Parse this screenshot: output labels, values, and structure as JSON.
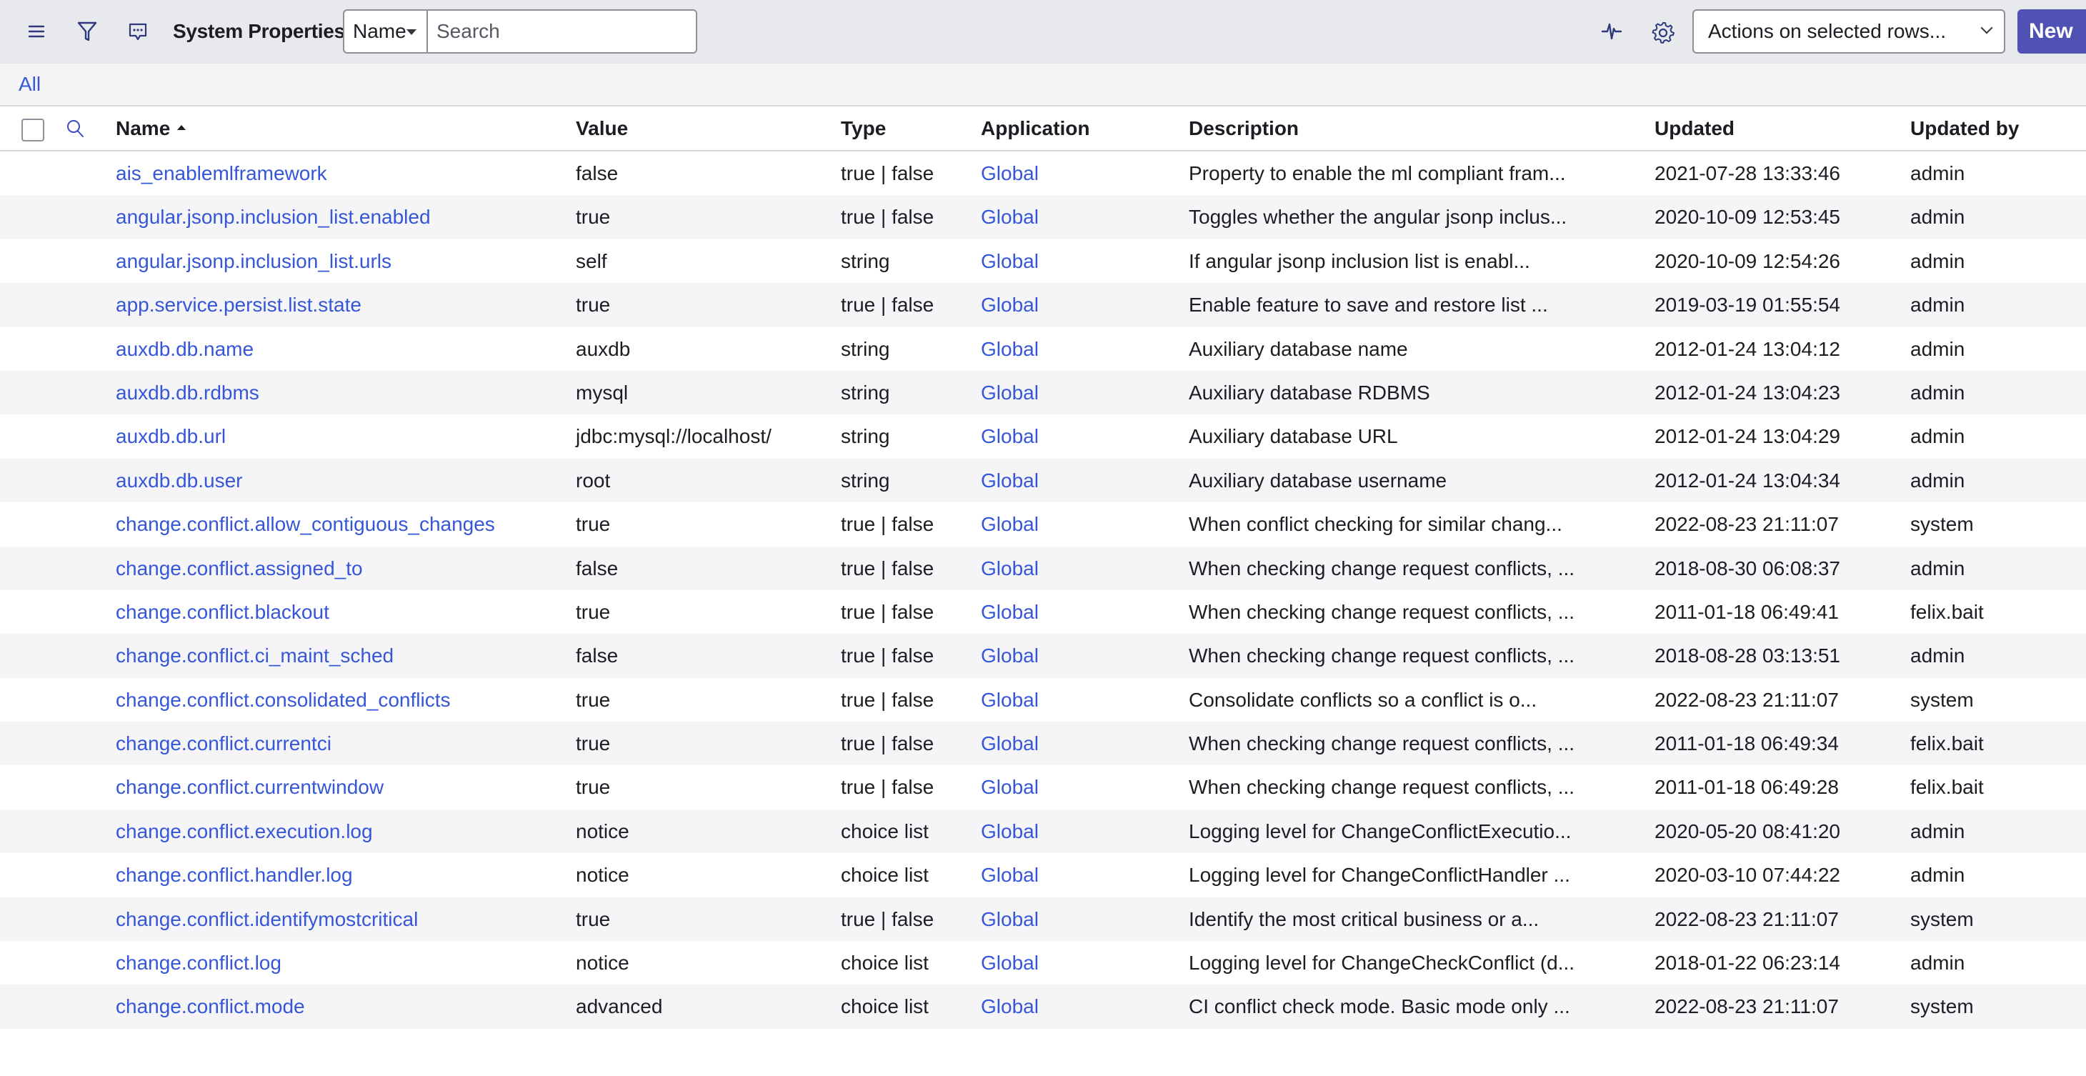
{
  "header": {
    "title": "System Properties",
    "search_field": "Name",
    "search_placeholder": "Search",
    "actions_select": "Actions on selected rows...",
    "new_button": "New",
    "icons": {
      "menu": "hamburger-menu-icon",
      "filter": "funnel-filter-icon",
      "chat": "chat-bubble-icon",
      "activity": "pulse-activity-icon",
      "settings": "gear-icon"
    }
  },
  "filter": {
    "breadcrumb": "All"
  },
  "colors": {
    "accent": "#4f52b2",
    "link": "#3656d8",
    "icon": "#2e3a7c"
  },
  "table": {
    "columns": [
      "Name",
      "Value",
      "Type",
      "Application",
      "Description",
      "Updated",
      "Updated by"
    ],
    "sort": {
      "column": "Name",
      "direction": "ascending"
    },
    "rows": [
      {
        "name": "ais_enablemlframework",
        "value": "false",
        "type": "true | false",
        "application": "Global",
        "description": "Property to enable the ml compliant fram...",
        "updated": "2021-07-28 13:33:46",
        "updated_by": "admin"
      },
      {
        "name": "angular.jsonp.inclusion_list.enabled",
        "value": "true",
        "type": "true | false",
        "application": "Global",
        "description": "Toggles whether the angular jsonp inclus...",
        "updated": "2020-10-09 12:53:45",
        "updated_by": "admin"
      },
      {
        "name": "angular.jsonp.inclusion_list.urls",
        "value": "self",
        "type": "string",
        "application": "Global",
        "description": "If angular jsonp inclusion list is enabl...",
        "updated": "2020-10-09 12:54:26",
        "updated_by": "admin"
      },
      {
        "name": "app.service.persist.list.state",
        "value": "true",
        "type": "true | false",
        "application": "Global",
        "description": "Enable feature to save and restore list ...",
        "updated": "2019-03-19 01:55:54",
        "updated_by": "admin"
      },
      {
        "name": "auxdb.db.name",
        "value": "auxdb",
        "type": "string",
        "application": "Global",
        "description": "Auxiliary database name",
        "updated": "2012-01-24 13:04:12",
        "updated_by": "admin"
      },
      {
        "name": "auxdb.db.rdbms",
        "value": "mysql",
        "type": "string",
        "application": "Global",
        "description": "Auxiliary database RDBMS",
        "updated": "2012-01-24 13:04:23",
        "updated_by": "admin"
      },
      {
        "name": "auxdb.db.url",
        "value": "jdbc:mysql://localhost/",
        "type": "string",
        "application": "Global",
        "description": "Auxiliary database URL",
        "updated": "2012-01-24 13:04:29",
        "updated_by": "admin"
      },
      {
        "name": "auxdb.db.user",
        "value": "root",
        "type": "string",
        "application": "Global",
        "description": "Auxiliary database username",
        "updated": "2012-01-24 13:04:34",
        "updated_by": "admin"
      },
      {
        "name": "change.conflict.allow_contiguous_changes",
        "value": "true",
        "type": "true | false",
        "application": "Global",
        "description": "When conflict checking for similar chang...",
        "updated": "2022-08-23 21:11:07",
        "updated_by": "system"
      },
      {
        "name": "change.conflict.assigned_to",
        "value": "false",
        "type": "true | false",
        "application": "Global",
        "description": "When checking change request conflicts, ...",
        "updated": "2018-08-30 06:08:37",
        "updated_by": "admin"
      },
      {
        "name": "change.conflict.blackout",
        "value": "true",
        "type": "true | false",
        "application": "Global",
        "description": "When checking change request conflicts, ...",
        "updated": "2011-01-18 06:49:41",
        "updated_by": "felix.bait"
      },
      {
        "name": "change.conflict.ci_maint_sched",
        "value": "false",
        "type": "true | false",
        "application": "Global",
        "description": "When checking change request conflicts, ...",
        "updated": "2018-08-28 03:13:51",
        "updated_by": "admin"
      },
      {
        "name": "change.conflict.consolidated_conflicts",
        "value": "true",
        "type": "true | false",
        "application": "Global",
        "description": "Consolidate conflicts so a conflict is o...",
        "updated": "2022-08-23 21:11:07",
        "updated_by": "system"
      },
      {
        "name": "change.conflict.currentci",
        "value": "true",
        "type": "true | false",
        "application": "Global",
        "description": "When checking change request conflicts, ...",
        "updated": "2011-01-18 06:49:34",
        "updated_by": "felix.bait"
      },
      {
        "name": "change.conflict.currentwindow",
        "value": "true",
        "type": "true | false",
        "application": "Global",
        "description": "When checking change request conflicts, ...",
        "updated": "2011-01-18 06:49:28",
        "updated_by": "felix.bait"
      },
      {
        "name": "change.conflict.execution.log",
        "value": "notice",
        "type": "choice list",
        "application": "Global",
        "description": "Logging level for ChangeConflictExecutio...",
        "updated": "2020-05-20 08:41:20",
        "updated_by": "admin"
      },
      {
        "name": "change.conflict.handler.log",
        "value": "notice",
        "type": "choice list",
        "application": "Global",
        "description": "Logging level for ChangeConflictHandler ...",
        "updated": "2020-03-10 07:44:22",
        "updated_by": "admin"
      },
      {
        "name": "change.conflict.identifymostcritical",
        "value": "true",
        "type": "true | false",
        "application": "Global",
        "description": "Identify the most critical business or a...",
        "updated": "2022-08-23 21:11:07",
        "updated_by": "system"
      },
      {
        "name": "change.conflict.log",
        "value": "notice",
        "type": "choice list",
        "application": "Global",
        "description": "Logging level for ChangeCheckConflict (d...",
        "updated": "2018-01-22 06:23:14",
        "updated_by": "admin"
      },
      {
        "name": "change.conflict.mode",
        "value": "advanced",
        "type": "choice list",
        "application": "Global",
        "description": "CI conflict check mode. Basic mode only ...",
        "updated": "2022-08-23 21:11:07",
        "updated_by": "system"
      }
    ]
  }
}
